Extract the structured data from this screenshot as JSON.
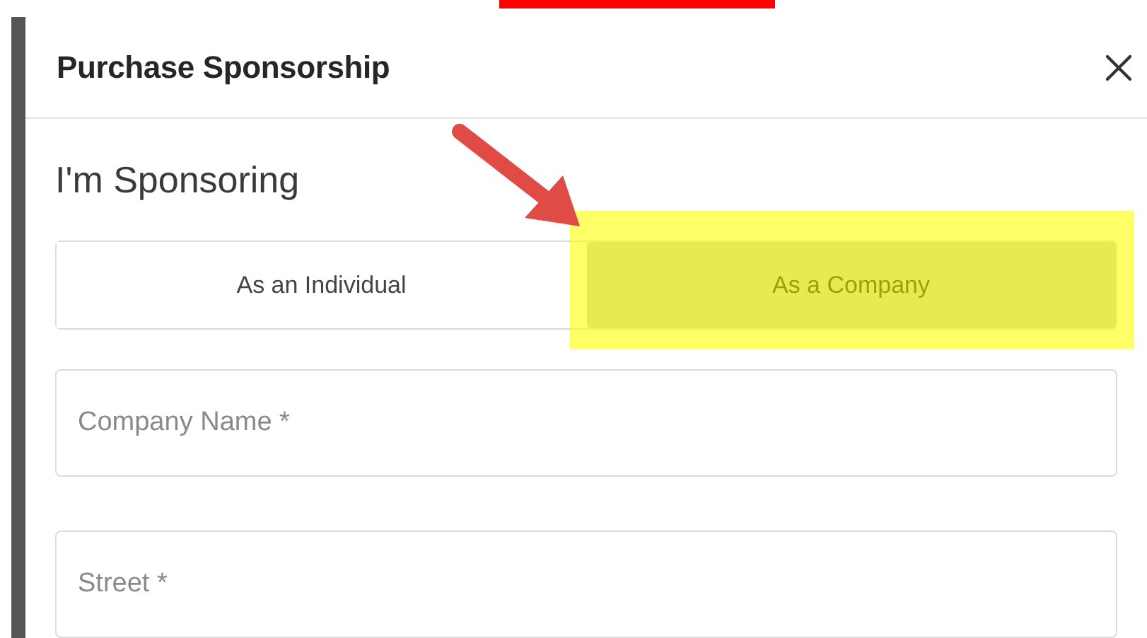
{
  "modal": {
    "title": "Purchase Sponsorship"
  },
  "section_label": "I'm Sponsoring",
  "options": [
    {
      "label": "As an Individual",
      "selected": false
    },
    {
      "label": "As a Company",
      "selected": true
    }
  ],
  "fields": [
    {
      "placeholder": "Company Name *"
    },
    {
      "placeholder": "Street *"
    }
  ]
}
